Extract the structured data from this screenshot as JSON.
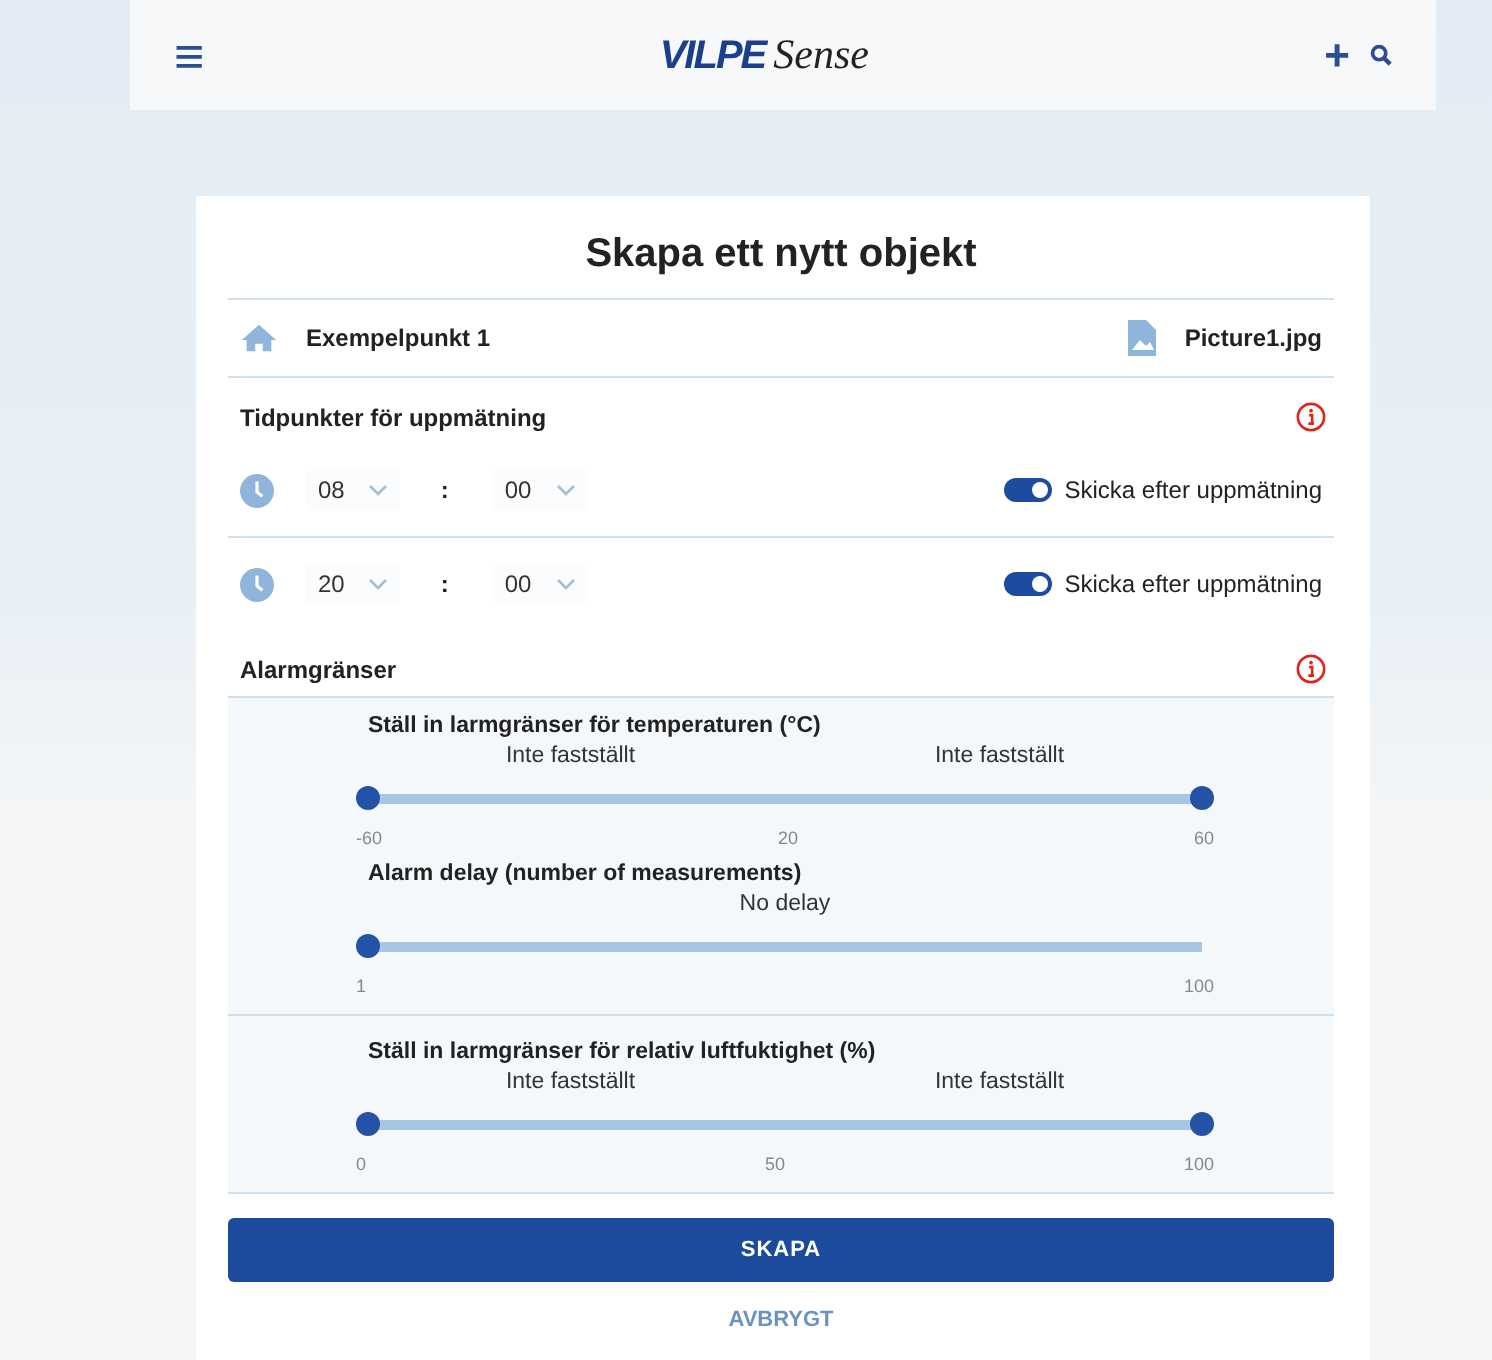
{
  "header": {
    "menu_icon": "≡",
    "logo": {
      "brand": "VILPE",
      "product": "Sense"
    },
    "actions": [
      "+"
    ]
  },
  "form": {
    "title": "Skapa ett nytt objekt",
    "location": "Exempelpunkt 1",
    "file": "Picture1.jpg",
    "times_heading": "Tidpunkter för uppmätning",
    "times": [
      {
        "hour": "08",
        "separator": ":",
        "minute": "00",
        "send": {
          "label": "Skicka efter uppmätning",
          "on": true
        }
      },
      {
        "hour": "20",
        "separator": ":",
        "minute": "00",
        "send": {
          "label": "Skicka efter uppmätning",
          "on": true
        }
      }
    ],
    "alarms_heading": "Alarmgränser",
    "slider_groups": [
      [
        {
          "title": "Ställ in larmgränser för temperaturen (°C)",
          "value_labels": [
            "Inte fastställt",
            "Inte fastställt"
          ],
          "thumbs": [
            {
              "level": 0
            },
            {
              "level": 1
            }
          ],
          "ticks": [
            "-60",
            "20",
            "60"
          ]
        },
        {
          "title": "Alarm delay (number of measurements)",
          "value_labels": [
            "No delay"
          ],
          "thumbs": [
            {
              "level": 0
            }
          ],
          "ticks": [
            "1",
            "100"
          ]
        }
      ],
      [
        {
          "title": "Ställ in larmgränser för relativ luftfuktighet (%)",
          "value_labels": [
            "Inte fastställt",
            "Inte fastställt"
          ],
          "thumbs": [
            {
              "level": 0
            },
            {
              "level": 1
            }
          ],
          "ticks": [
            "0",
            "50",
            "100"
          ]
        }
      ]
    ],
    "submit": "SKAPA",
    "cancel": "AVBRYGT"
  }
}
